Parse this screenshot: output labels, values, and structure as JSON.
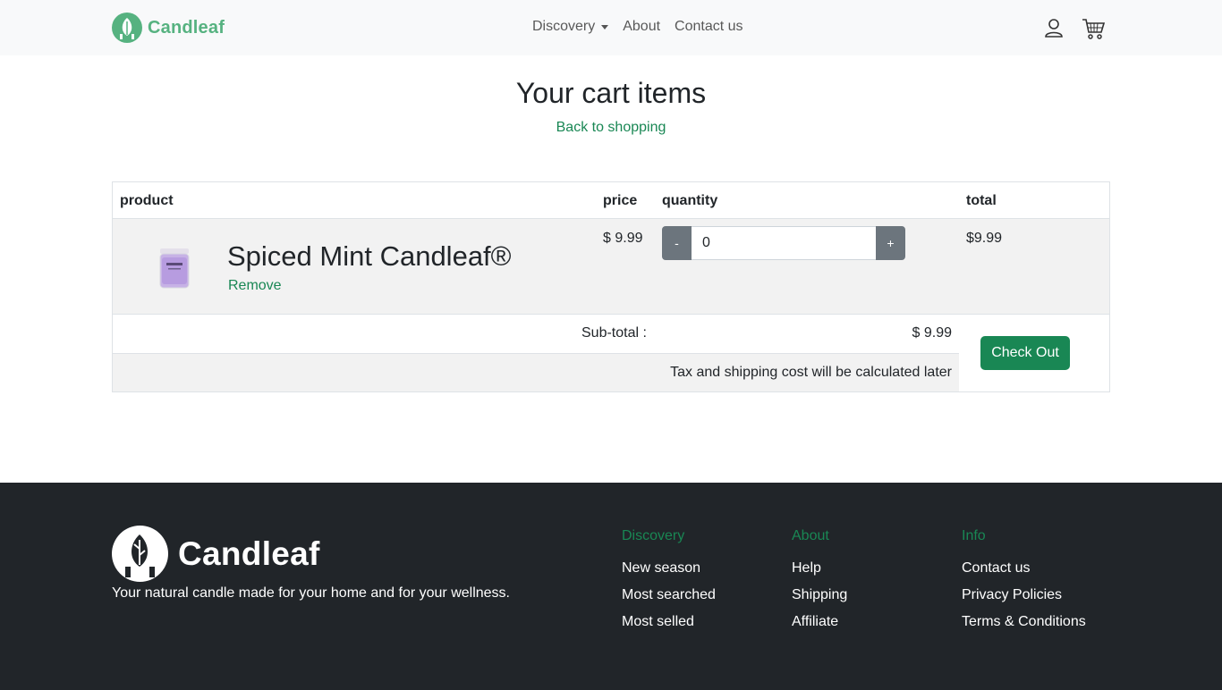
{
  "brand": {
    "name": "Candleaf",
    "accent": "#56b280"
  },
  "nav": {
    "links": [
      "Discovery",
      "About",
      "Contact us"
    ],
    "icons": [
      "user-icon",
      "cart-icon"
    ]
  },
  "page": {
    "title": "Your cart items",
    "back_link": "Back to shopping"
  },
  "cart": {
    "columns": [
      "product",
      "price",
      "quantity",
      "total"
    ],
    "items": [
      {
        "name": "Spiced Mint Candleaf®",
        "remove_label": "Remove",
        "price": "$ 9.99",
        "quantity": "0",
        "minus_label": "-",
        "plus_label": "+",
        "total": "$9.99"
      }
    ],
    "subtotal_label": "Sub-total :",
    "subtotal_value": "$ 9.99",
    "tax_note": "Tax and shipping cost will be calculated later",
    "checkout_label": "Check Out"
  },
  "footer": {
    "brand_name": "Candleaf",
    "tagline": "Your natural candle made for your home and for your wellness.",
    "columns": [
      {
        "heading": "Discovery",
        "items": [
          "New season",
          "Most searched",
          "Most selled"
        ]
      },
      {
        "heading": "About",
        "items": [
          "Help",
          "Shipping",
          "Affiliate"
        ]
      },
      {
        "heading": "Info",
        "items": [
          "Contact us",
          "Privacy Policies",
          "Terms & Conditions"
        ]
      }
    ]
  },
  "colors": {
    "primary_green": "#198754",
    "footer_bg": "#212529",
    "qty_button": "#6c757d"
  }
}
